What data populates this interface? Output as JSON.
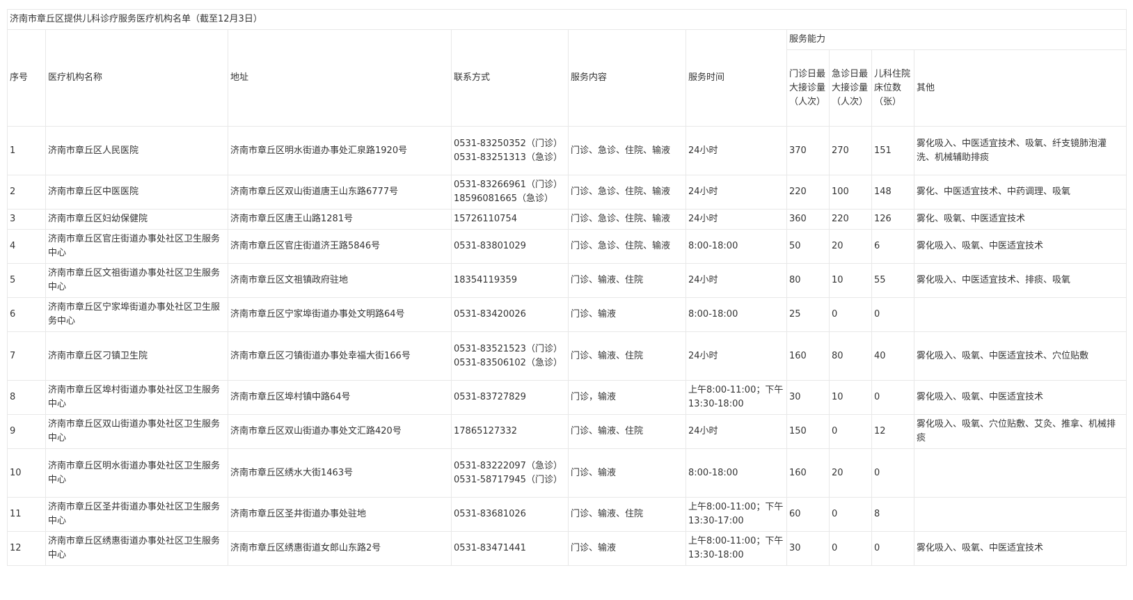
{
  "table": {
    "title": "济南市章丘区提供儿科诊疗服务医疗机构名单（截至12月3日）",
    "headers": {
      "index": "序号",
      "name": "医疗机构名称",
      "address": "地址",
      "contact": "联系方式",
      "services": "服务内容",
      "hours": "服务时间",
      "capacity": "服务能力",
      "outpatient": "门诊日最大接诊量（人次）",
      "emergency": "急诊日最大接诊量（人次）",
      "beds": "儿科住院床位数（张）",
      "other": "其他"
    },
    "rows": [
      {
        "index": "1",
        "name": "济南市章丘区人民医院",
        "address": "济南市章丘区明水街道办事处汇泉路1920号",
        "contact": "0531-83250352（门诊）\n0531-83251313（急诊）",
        "services": "门诊、急诊、住院、输液",
        "hours": "24小时",
        "outpatient": "370",
        "emergency": "270",
        "beds": "151",
        "other": "雾化吸入、中医适宜技术、吸氧、纤支镜肺泡灌洗、机械辅助排痰"
      },
      {
        "index": "2",
        "name": "济南市章丘区中医医院",
        "address": "济南市章丘区双山街道唐王山东路6777号",
        "contact": "0531-83266961（门诊）\n18596081665（急诊）",
        "services": "门诊、急诊、住院、输液",
        "hours": "24小时",
        "outpatient": "220",
        "emergency": "100",
        "beds": "148",
        "other": "雾化、中医适宜技术、中药调理、吸氧"
      },
      {
        "index": "3",
        "name": "济南市章丘区妇幼保健院",
        "address": "济南市章丘区唐王山路1281号",
        "contact": "15726110754",
        "services": "门诊、急诊、住院、输液",
        "hours": "24小时",
        "outpatient": "360",
        "emergency": "220",
        "beds": "126",
        "other": "雾化、吸氧、中医适宜技术"
      },
      {
        "index": "4",
        "name": "济南市章丘区官庄街道办事处社区卫生服务中心",
        "address": "济南市章丘区官庄街道济王路5846号",
        "contact": "0531-83801029",
        "services": "门诊、急诊、住院、输液",
        "hours": "8:00-18:00",
        "outpatient": "50",
        "emergency": "20",
        "beds": "6",
        "other": "雾化吸入、吸氧、中医适宜技术"
      },
      {
        "index": "5",
        "name": "济南市章丘区文祖街道办事处社区卫生服务中心",
        "address": "济南市章丘区文祖镇政府驻地",
        "contact": "18354119359",
        "services": "门诊、输液、住院",
        "hours": "24小时",
        "outpatient": "80",
        "emergency": "10",
        "beds": "55",
        "other": "雾化吸入、中医适宜技术、排痰、吸氧"
      },
      {
        "index": "6",
        "name": "济南市章丘区宁家埠街道办事处社区卫生服务中心",
        "address": "济南市章丘区宁家埠街道办事处文明路64号",
        "contact": "0531-83420026",
        "services": "门诊、输液",
        "hours": "8:00-18:00",
        "outpatient": "25",
        "emergency": "0",
        "beds": "0",
        "other": ""
      },
      {
        "index": "7",
        "name": "济南市章丘区刁镇卫生院",
        "address": "济南市章丘区刁镇街道办事处幸福大街166号",
        "contact": "0531-83521523（门诊）\n0531-83506102（急诊）",
        "services": "门诊、输液、住院",
        "hours": "24小时",
        "outpatient": "160",
        "emergency": "80",
        "beds": "40",
        "other": "雾化吸入、吸氧、中医适宜技术、穴位贴敷"
      },
      {
        "index": "8",
        "name": "济南市章丘区埠村街道办事处社区卫生服务中心",
        "address": "济南市章丘区埠村镇中路64号",
        "contact": "0531-83727829",
        "services": "门诊，输液",
        "hours": "上午8:00-11:00；下午13:30-18:00",
        "outpatient": "30",
        "emergency": "10",
        "beds": "0",
        "other": "雾化吸入、吸氧、中医适宜技术"
      },
      {
        "index": "9",
        "name": "济南市章丘区双山街道办事处社区卫生服务中心",
        "address": "济南市章丘区双山街道办事处文汇路420号",
        "contact": "17865127332",
        "services": "门诊、输液、住院",
        "hours": "24小时",
        "outpatient": "150",
        "emergency": "0",
        "beds": "12",
        "other": "雾化吸入、吸氧、穴位贴敷、艾灸、推拿、机械排痰"
      },
      {
        "index": "10",
        "name": "济南市章丘区明水街道办事处社区卫生服务中心",
        "address": "济南市章丘区绣水大街1463号",
        "contact": "0531-83222097（急诊）\n0531-58717945（门诊）",
        "services": "门诊、输液",
        "hours": "8:00-18:00",
        "outpatient": "160",
        "emergency": "20",
        "beds": "0",
        "other": ""
      },
      {
        "index": "11",
        "name": "济南市章丘区圣井街道办事处社区卫生服务中心",
        "address": "济南市章丘区圣井街道办事处驻地",
        "contact": "0531-83681026",
        "services": "门诊、输液、住院",
        "hours": "上午8:00-11:00；下午13:30-17:00",
        "outpatient": "60",
        "emergency": "0",
        "beds": "8",
        "other": ""
      },
      {
        "index": "12",
        "name": "济南市章丘区绣惠街道办事处社区卫生服务中心",
        "address": "济南市章丘区绣惠街道女郎山东路2号",
        "contact": "0531-83471441",
        "services": "门诊、输液",
        "hours": "上午8:00-11:00；下午13:30-18:00",
        "outpatient": "30",
        "emergency": "0",
        "beds": "0",
        "other": "雾化吸入、吸氧、中医适宜技术"
      }
    ]
  }
}
